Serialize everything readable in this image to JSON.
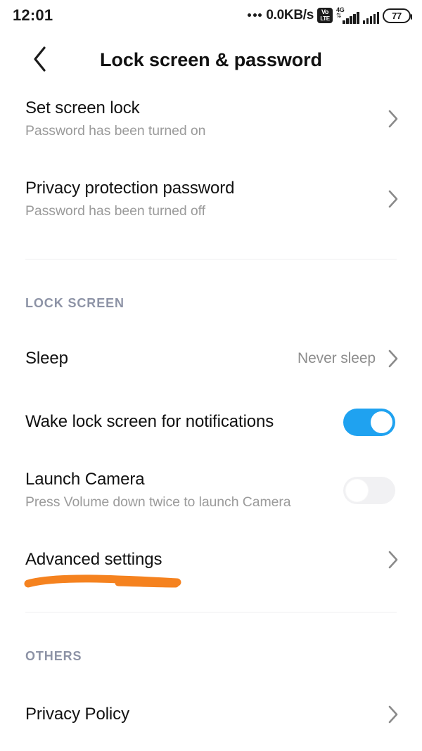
{
  "status_bar": {
    "time": "12:01",
    "network_speed": "0.0KB/s",
    "volte_top": "Vo",
    "volte_bottom": "LTE",
    "network_type": "4G",
    "battery_level": "77"
  },
  "app_bar": {
    "title": "Lock screen & password",
    "back_icon": "chevron-left-icon"
  },
  "sections": [
    {
      "id": "top",
      "header": null,
      "items": [
        {
          "title": "Set screen lock",
          "subtitle": "Password has been turned on",
          "accessory": "chevron"
        },
        {
          "title": "Privacy protection password",
          "subtitle": "Password has been turned off",
          "accessory": "chevron"
        }
      ]
    },
    {
      "id": "lock_screen",
      "header": "LOCK SCREEN",
      "items": [
        {
          "title": "Sleep",
          "subtitle": null,
          "value": "Never sleep",
          "accessory": "chevron"
        },
        {
          "title": "Wake lock screen for notifications",
          "subtitle": null,
          "accessory": "toggle",
          "toggle_state": "on"
        },
        {
          "title": "Launch Camera",
          "subtitle": "Press Volume down twice to launch Camera",
          "accessory": "toggle",
          "toggle_state": "off"
        },
        {
          "title": "Advanced settings",
          "subtitle": null,
          "accessory": "chevron",
          "annotated": true
        }
      ]
    },
    {
      "id": "others",
      "header": "OTHERS",
      "items": [
        {
          "title": "Privacy Policy",
          "subtitle": null,
          "accessory": "chevron"
        }
      ]
    }
  ],
  "annotation": {
    "type": "handdrawn-underline",
    "color": "#F5821F",
    "target": "Advanced settings"
  },
  "colors": {
    "accent_toggle_on": "#1fa2f0",
    "toggle_off_track": "#f1f1f3",
    "section_header": "#8d93a6",
    "subtitle": "#9b9b9b",
    "chevron": "#8a8a8a",
    "divider": "#ededef",
    "annotation_orange": "#F5821F"
  }
}
